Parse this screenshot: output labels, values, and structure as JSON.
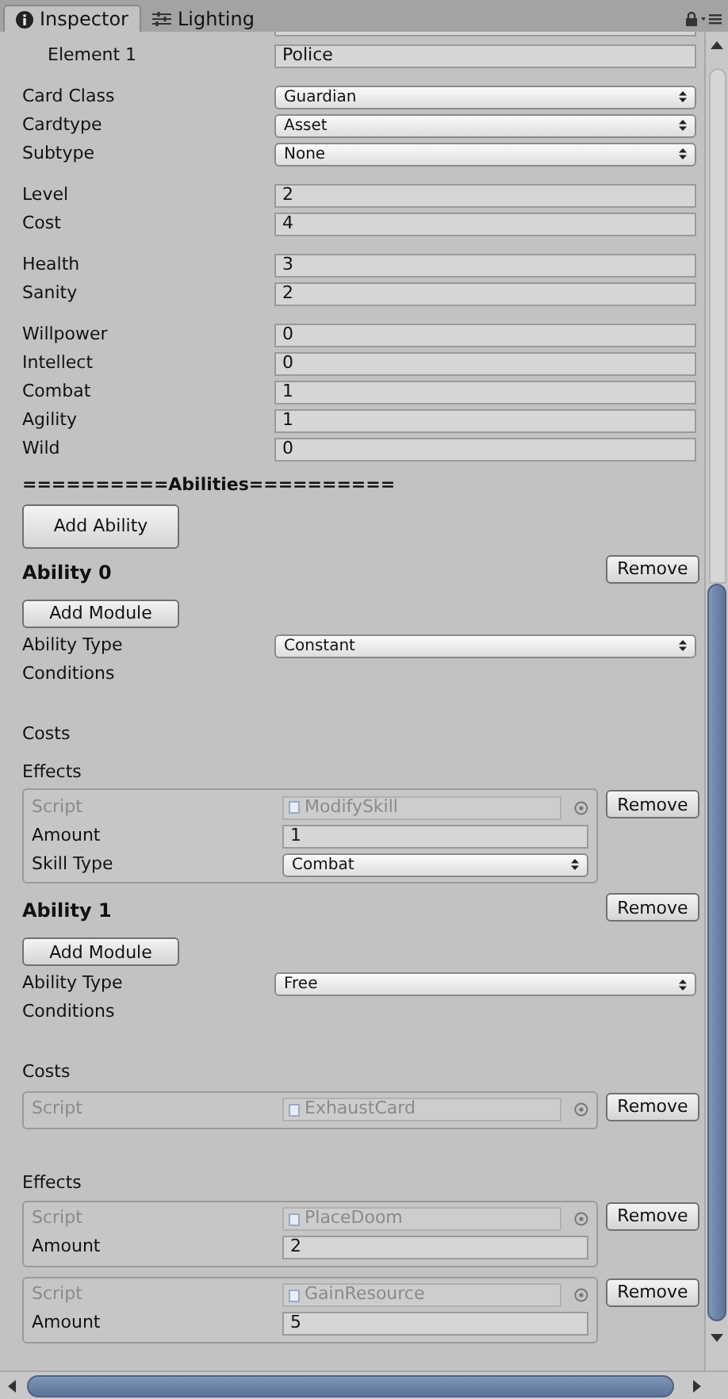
{
  "tabs": [
    {
      "label": "Inspector",
      "selected": true
    },
    {
      "label": "Lighting",
      "selected": false
    }
  ],
  "traits": [
    {
      "label": "Element 1",
      "value": "Police"
    }
  ],
  "groups": [
    [
      {
        "label": "Card Class",
        "value": "Guardian",
        "kind": "dropdown"
      },
      {
        "label": "Cardtype",
        "value": "Asset",
        "kind": "dropdown"
      },
      {
        "label": "Subtype",
        "value": "None",
        "kind": "dropdown"
      }
    ],
    [
      {
        "label": "Level",
        "value": "2",
        "kind": "text"
      },
      {
        "label": "Cost",
        "value": "4",
        "kind": "text"
      }
    ],
    [
      {
        "label": "Health",
        "value": "3",
        "kind": "text"
      },
      {
        "label": "Sanity",
        "value": "2",
        "kind": "text"
      }
    ],
    [
      {
        "label": "Willpower",
        "value": "0",
        "kind": "text"
      },
      {
        "label": "Intellect",
        "value": "0",
        "kind": "text"
      },
      {
        "label": "Combat",
        "value": "1",
        "kind": "text"
      },
      {
        "label": "Agility",
        "value": "1",
        "kind": "text"
      },
      {
        "label": "Wild",
        "value": "0",
        "kind": "text"
      }
    ]
  ],
  "abilities_header": "==========Abilities==========",
  "add_ability": "Add Ability",
  "abilities": [
    {
      "title": "Ability 0",
      "remove": "Remove",
      "add_module": "Add Module",
      "type_label": "Ability Type",
      "type_value": "Constant",
      "conditions_label": "Conditions",
      "costs_label": "Costs",
      "effects_label": "Effects",
      "effects": [
        {
          "script_label": "Script",
          "script": "ModifySkill",
          "remove": "Remove",
          "fields": [
            {
              "label": "Amount",
              "value": "1",
              "kind": "text"
            },
            {
              "label": "Skill Type",
              "value": "Combat",
              "kind": "dropdown"
            }
          ]
        }
      ]
    },
    {
      "title": "Ability 1",
      "remove": "Remove",
      "add_module": "Add Module",
      "type_label": "Ability Type",
      "type_value": "Free",
      "conditions_label": "Conditions",
      "costs_label": "Costs",
      "costs": [
        {
          "script_label": "Script",
          "script": "ExhaustCard",
          "remove": "Remove"
        }
      ],
      "effects_label": "Effects",
      "effects": [
        {
          "script_label": "Script",
          "script": "PlaceDoom",
          "remove": "Remove",
          "fields": [
            {
              "label": "Amount",
              "value": "2",
              "kind": "text"
            }
          ]
        },
        {
          "script_label": "Script",
          "script": "GainResource",
          "remove": "Remove",
          "fields": [
            {
              "label": "Amount",
              "value": "5",
              "kind": "text"
            }
          ]
        }
      ]
    }
  ]
}
